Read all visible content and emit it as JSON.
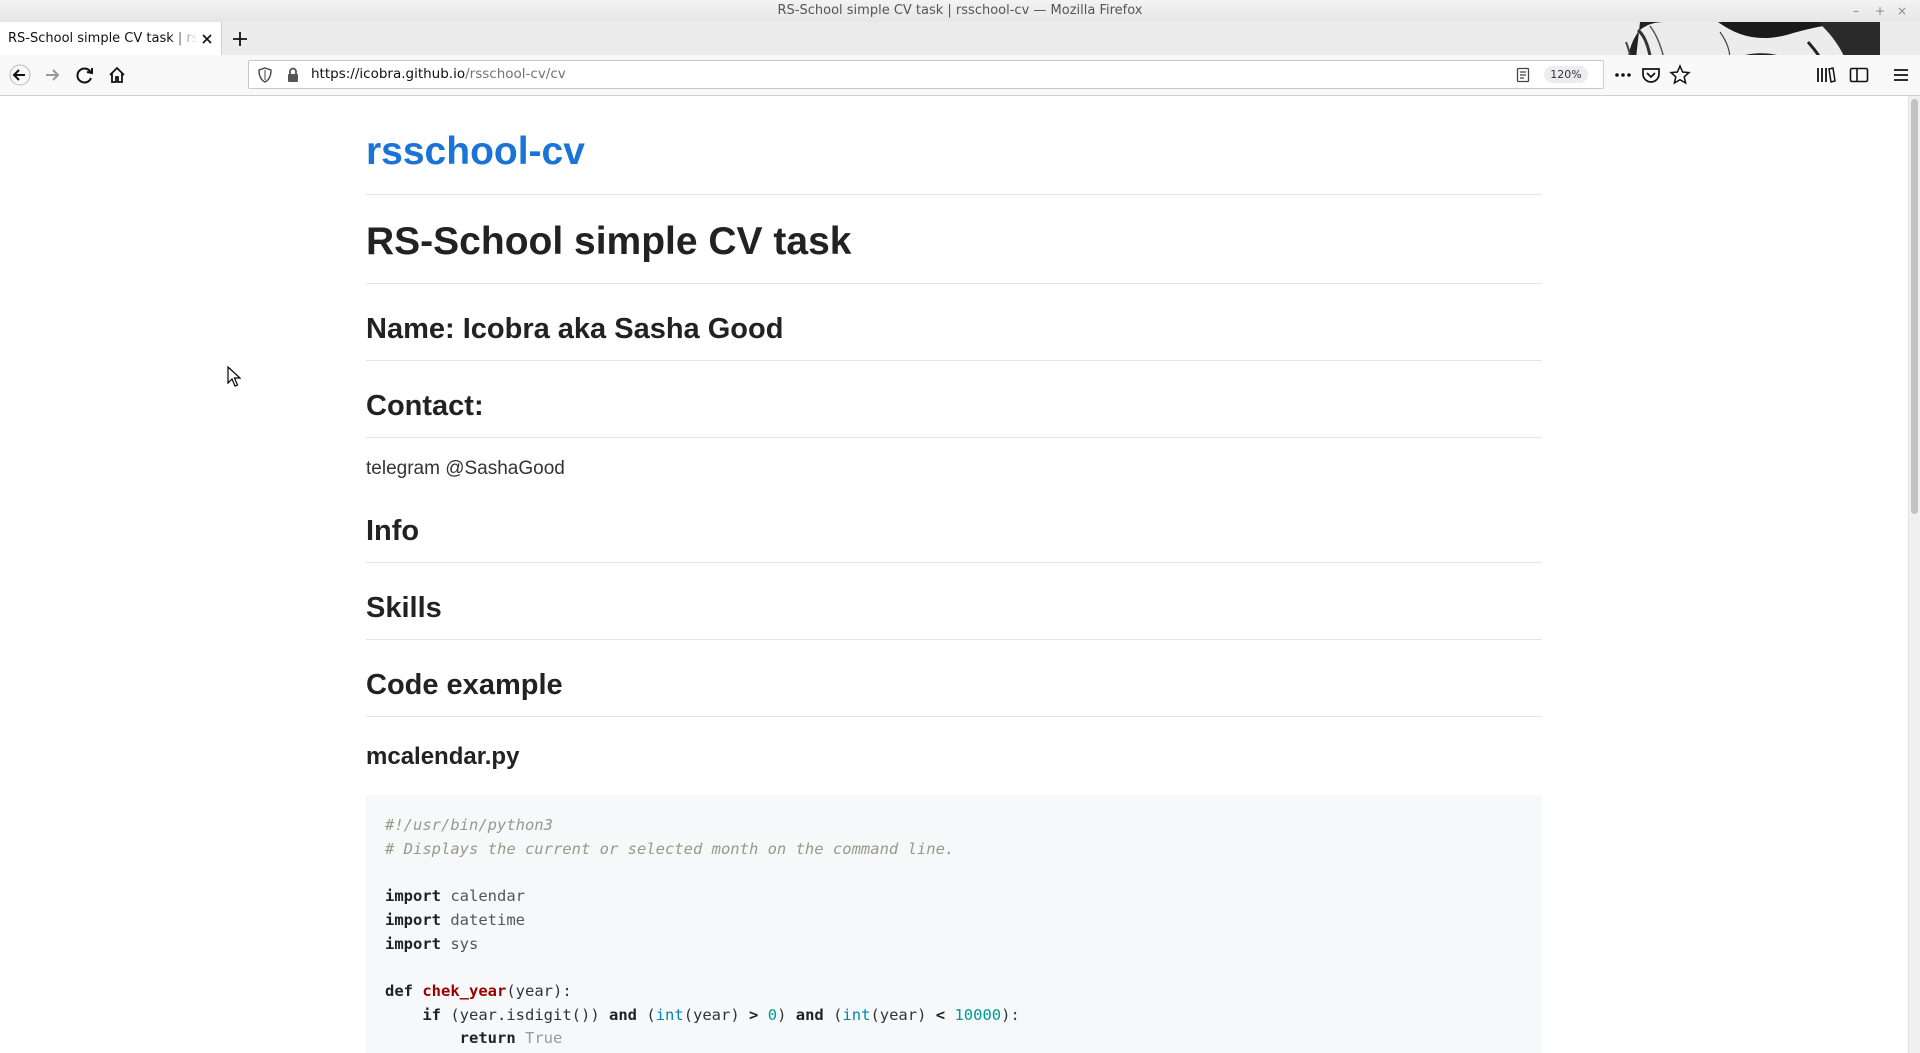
{
  "window": {
    "title": "RS-School simple CV task | rsschool-cv — Mozilla Firefox",
    "controls": {
      "minimize": "–",
      "maximize": "+",
      "close": "×"
    }
  },
  "tabs": [
    {
      "title": "RS-School simple CV task | rsschool-cv",
      "active": true
    }
  ],
  "urlbar": {
    "url_host": "https://icobra.github.io",
    "url_path": "/rsschool-cv/cv",
    "zoom": "120%"
  },
  "page": {
    "site_title": "rsschool-cv",
    "heading": "RS-School simple CV task",
    "name_heading": "Name: Icobra aka Sasha Good",
    "contact_heading": "Contact:",
    "contact_text": "telegram @SashaGood",
    "info_heading": "Info",
    "skills_heading": "Skills",
    "code_heading": "Code example",
    "file_heading": "mcalendar.py",
    "code_lines": {
      "l1": "#!/usr/bin/python3",
      "l2": "# Displays the current or selected month on the command line.",
      "l4_kw": "import",
      "l4_mod": "calendar",
      "l5_kw": "import",
      "l5_mod": "datetime",
      "l6_kw": "import",
      "l6_mod": "sys",
      "l8_def": "def",
      "l8_fn": "chek_year",
      "l8_rest": "(year):",
      "l9_if": "if",
      "l9_a": "(year.isdigit())",
      "l9_and1": "and",
      "l9_b": "(",
      "l9_int1": "int",
      "l9_c": "(year)",
      "l9_gt": ">",
      "l9_zero": "0",
      "l9_d": ")",
      "l9_and2": "and",
      "l9_e": "(",
      "l9_int2": "int",
      "l9_f": "(year)",
      "l9_lt": "<",
      "l9_num": "10000",
      "l9_g": "):",
      "l10_ret": "return",
      "l10_val": "True"
    }
  },
  "colors": {
    "link": "#1a73d6",
    "code_bg": "#f6f8fa",
    "comment": "#999988",
    "function": "#990000",
    "builtin": "#0086b3",
    "number": "#009999"
  }
}
